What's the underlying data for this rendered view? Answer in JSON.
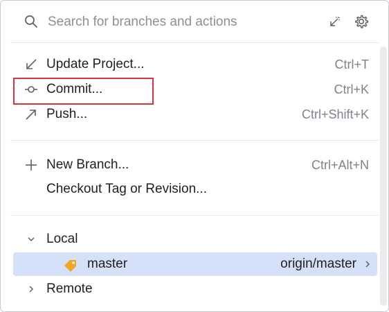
{
  "search": {
    "placeholder": "Search for branches and actions",
    "icon": "search-icon",
    "collapse_icon": "collapse-icon",
    "settings_icon": "gear-icon"
  },
  "actions": [
    {
      "label": "Update Project...",
      "shortcut": "Ctrl+T",
      "icon": "arrow-down-left-icon"
    },
    {
      "label": "Commit...",
      "shortcut": "Ctrl+K",
      "icon": "commit-icon"
    },
    {
      "label": "Push...",
      "shortcut": "Ctrl+Shift+K",
      "icon": "arrow-up-right-icon"
    }
  ],
  "branch_actions": [
    {
      "label": "New Branch...",
      "shortcut": "Ctrl+Alt+N",
      "icon": "plus-icon"
    },
    {
      "label": "Checkout Tag or Revision...",
      "shortcut": ""
    }
  ],
  "local": {
    "label": "Local",
    "expanded": true,
    "branches": [
      {
        "name": "master",
        "tracking": "origin/master",
        "selected": true,
        "icon": "tag-icon"
      }
    ]
  },
  "remote": {
    "label": "Remote",
    "expanded": false
  },
  "colors": {
    "selected_row": "#d5e1f8",
    "highlight_border": "#d9323b",
    "tag_icon": "#f2a623"
  }
}
